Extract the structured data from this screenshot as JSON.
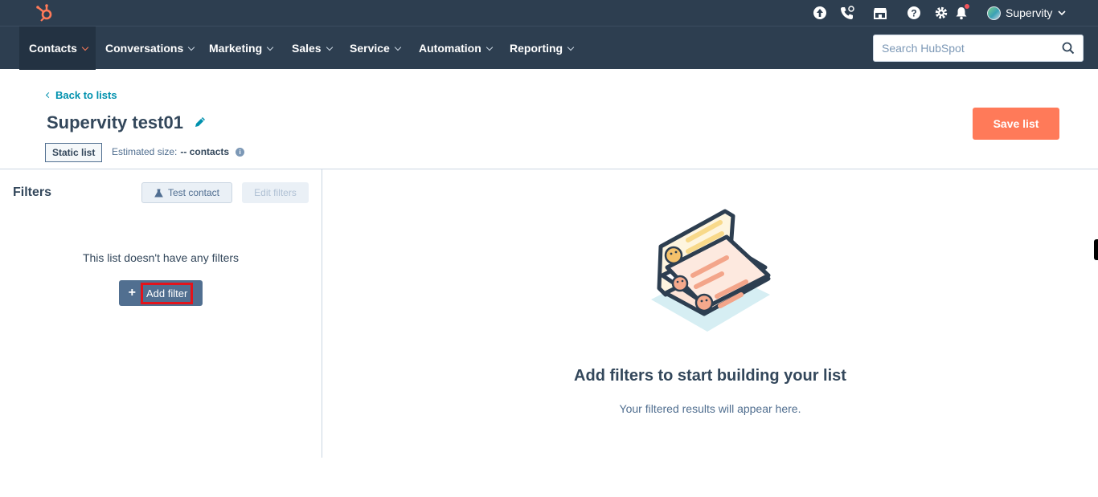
{
  "topbar": {
    "account_name": "Supervity"
  },
  "nav": {
    "items": [
      {
        "label": "Contacts"
      },
      {
        "label": "Conversations"
      },
      {
        "label": "Marketing"
      },
      {
        "label": "Sales"
      },
      {
        "label": "Service"
      },
      {
        "label": "Automation"
      },
      {
        "label": "Reporting"
      }
    ],
    "search_placeholder": "Search HubSpot"
  },
  "header": {
    "back_label": "Back to lists",
    "title": "Supervity test01",
    "list_type": "Static list",
    "estimated_label": "Estimated size:",
    "estimated_value": "-- contacts",
    "save_label": "Save list"
  },
  "filters": {
    "title": "Filters",
    "test_contact_label": "Test contact",
    "edit_filters_label": "Edit filters",
    "empty_text": "This list doesn't have any filters",
    "add_filter_label": "Add filter"
  },
  "results": {
    "empty_title": "Add filters to start building your list",
    "empty_subtitle": "Your filtered results will appear here."
  },
  "colors": {
    "nav_bg": "#2d3e50",
    "accent": "#ff7a59",
    "link": "#0091ae",
    "highlight": "#e3141b"
  }
}
